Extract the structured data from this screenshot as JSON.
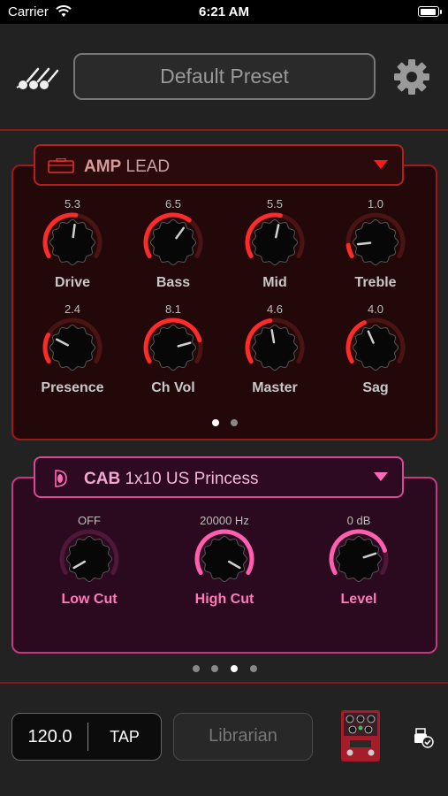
{
  "status_bar": {
    "carrier": "Carrier",
    "time": "6:21 AM"
  },
  "header": {
    "preset_name": "Default Preset",
    "menu_icon": "guitar-pegs-icon",
    "settings_icon": "gear-icon"
  },
  "amp": {
    "type_label": "AMP",
    "model": "LEAD",
    "knobs": [
      {
        "label": "Drive",
        "value": "5.3"
      },
      {
        "label": "Bass",
        "value": "6.5"
      },
      {
        "label": "Mid",
        "value": "5.5"
      },
      {
        "label": "Treble",
        "value": "1.0"
      },
      {
        "label": "Presence",
        "value": "2.4"
      },
      {
        "label": "Ch Vol",
        "value": "8.1"
      },
      {
        "label": "Master",
        "value": "4.6"
      },
      {
        "label": "Sag",
        "value": "4.0"
      }
    ],
    "page_index": 0,
    "page_count": 2,
    "accent": "#ff2a2a"
  },
  "cab": {
    "type_label": "CAB",
    "model": "1x10 US Princess",
    "knobs": [
      {
        "label": "Low Cut",
        "value": "OFF",
        "level": 0.0
      },
      {
        "label": "High Cut",
        "value": "20000 Hz",
        "level": 1.0
      },
      {
        "label": "Level",
        "value": "0 dB",
        "level": 0.8
      }
    ],
    "accent": "#ff5fae"
  },
  "page_dots": {
    "count": 4,
    "active": 2
  },
  "footer": {
    "bpm": "120.0",
    "tap_label": "TAP",
    "librarian_label": "Librarian",
    "pedal_icon": "pedal-icon",
    "usb_icon": "usb-check-icon"
  }
}
